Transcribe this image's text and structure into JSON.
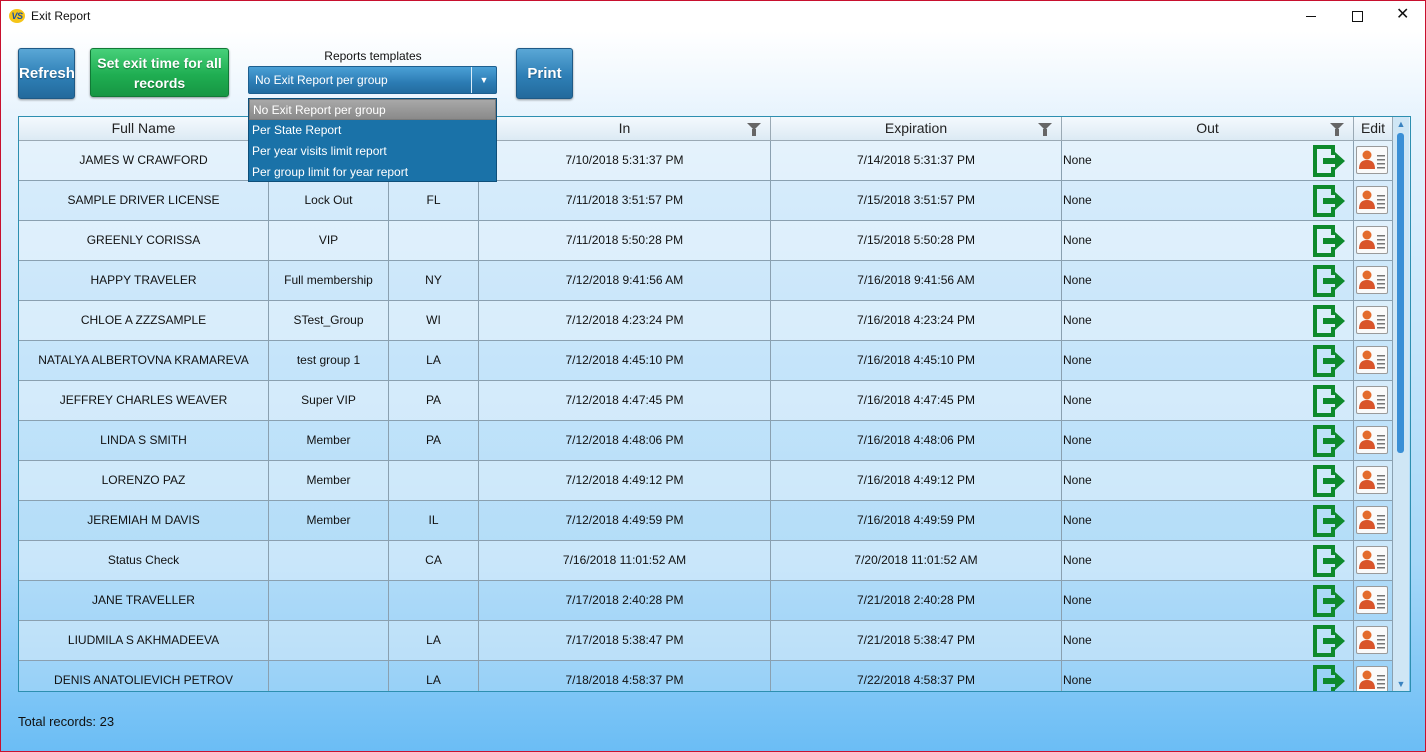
{
  "window": {
    "title": "Exit Report",
    "app_icon_text": "VS",
    "controls": [
      "minimize",
      "maximize",
      "close"
    ],
    "close_glyph": "✕"
  },
  "toolbar": {
    "refresh_label": "Refresh",
    "set_exit_label": "Set exit time for all records",
    "print_label": "Print",
    "templates_label": "Reports templates",
    "templates_selected": "No Exit Report per group",
    "templates_options": [
      "No Exit Report per group",
      "Per State Report",
      "Per year visits limit report",
      "Per group limit for year report"
    ],
    "dropdown_arrow": "▼"
  },
  "grid": {
    "headers": [
      "Full Name",
      "",
      "",
      "In",
      "Expiration",
      "Out",
      "Edit"
    ],
    "filterable_columns": [
      "In",
      "Expiration",
      "Out"
    ],
    "rows": [
      {
        "name": "JAMES W CRAWFORD",
        "group": "",
        "state": "",
        "in": "7/10/2018 5:31:37 PM",
        "expiration": "7/14/2018 5:31:37 PM",
        "out": "None"
      },
      {
        "name": "SAMPLE DRIVER LICENSE",
        "group": "Lock Out",
        "state": "FL",
        "in": "7/11/2018 3:51:57 PM",
        "expiration": "7/15/2018 3:51:57 PM",
        "out": "None"
      },
      {
        "name": "GREENLY CORISSA",
        "group": "VIP",
        "state": "",
        "in": "7/11/2018 5:50:28 PM",
        "expiration": "7/15/2018 5:50:28 PM",
        "out": "None"
      },
      {
        "name": "HAPPY  TRAVELER",
        "group": "Full membership",
        "state": "NY",
        "in": "7/12/2018 9:41:56 AM",
        "expiration": "7/16/2018 9:41:56 AM",
        "out": "None"
      },
      {
        "name": "CHLOE A ZZZSAMPLE",
        "group": "STest_Group",
        "state": "WI",
        "in": "7/12/2018 4:23:24 PM",
        "expiration": "7/16/2018 4:23:24 PM",
        "out": "None"
      },
      {
        "name": "NATALYA ALBERTOVNA KRAMAREVA",
        "group": "test group 1",
        "state": "LA",
        "in": "7/12/2018 4:45:10 PM",
        "expiration": "7/16/2018 4:45:10 PM",
        "out": "None"
      },
      {
        "name": "JEFFREY CHARLES WEAVER",
        "group": "Super VIP",
        "state": "PA",
        "in": "7/12/2018 4:47:45 PM",
        "expiration": "7/16/2018 4:47:45 PM",
        "out": "None"
      },
      {
        "name": "LINDA S SMITH",
        "group": "Member",
        "state": "PA",
        "in": "7/12/2018 4:48:06 PM",
        "expiration": "7/16/2018 4:48:06 PM",
        "out": "None"
      },
      {
        "name": "LORENZO  PAZ",
        "group": "Member",
        "state": "",
        "in": "7/12/2018 4:49:12 PM",
        "expiration": "7/16/2018 4:49:12 PM",
        "out": "None"
      },
      {
        "name": "JEREMIAH M DAVIS",
        "group": "Member",
        "state": "IL",
        "in": "7/12/2018 4:49:59 PM",
        "expiration": "7/16/2018 4:49:59 PM",
        "out": "None"
      },
      {
        "name": "Status  Check",
        "group": "",
        "state": "CA",
        "in": "7/16/2018 11:01:52 AM",
        "expiration": "7/20/2018 11:01:52 AM",
        "out": "None"
      },
      {
        "name": "JANE  TRAVELLER",
        "group": "",
        "state": "",
        "in": "7/17/2018 2:40:28 PM",
        "expiration": "7/21/2018 2:40:28 PM",
        "out": "None"
      },
      {
        "name": "LIUDMILA S AKHMADEEVA",
        "group": "",
        "state": "LA",
        "in": "7/17/2018 5:38:47 PM",
        "expiration": "7/21/2018 5:38:47 PM",
        "out": "None"
      },
      {
        "name": "DENIS ANATOLIEVICH PETROV",
        "group": "",
        "state": "LA",
        "in": "7/18/2018 4:58:37 PM",
        "expiration": "7/22/2018 4:58:37 PM",
        "out": "None"
      }
    ],
    "icons": {
      "exit": "exit-door-arrow-icon",
      "edit": "edit-person-card-icon"
    },
    "scroll_arrows": {
      "up": "▲",
      "down": "▼"
    }
  },
  "footer": {
    "total_label": "Total records:",
    "total_value": "23"
  },
  "colors": {
    "accent_blue": "#2e7fb6",
    "accent_green": "#1fae52",
    "exit_icon_green": "#0e8a2c",
    "window_border": "#c8102e"
  }
}
